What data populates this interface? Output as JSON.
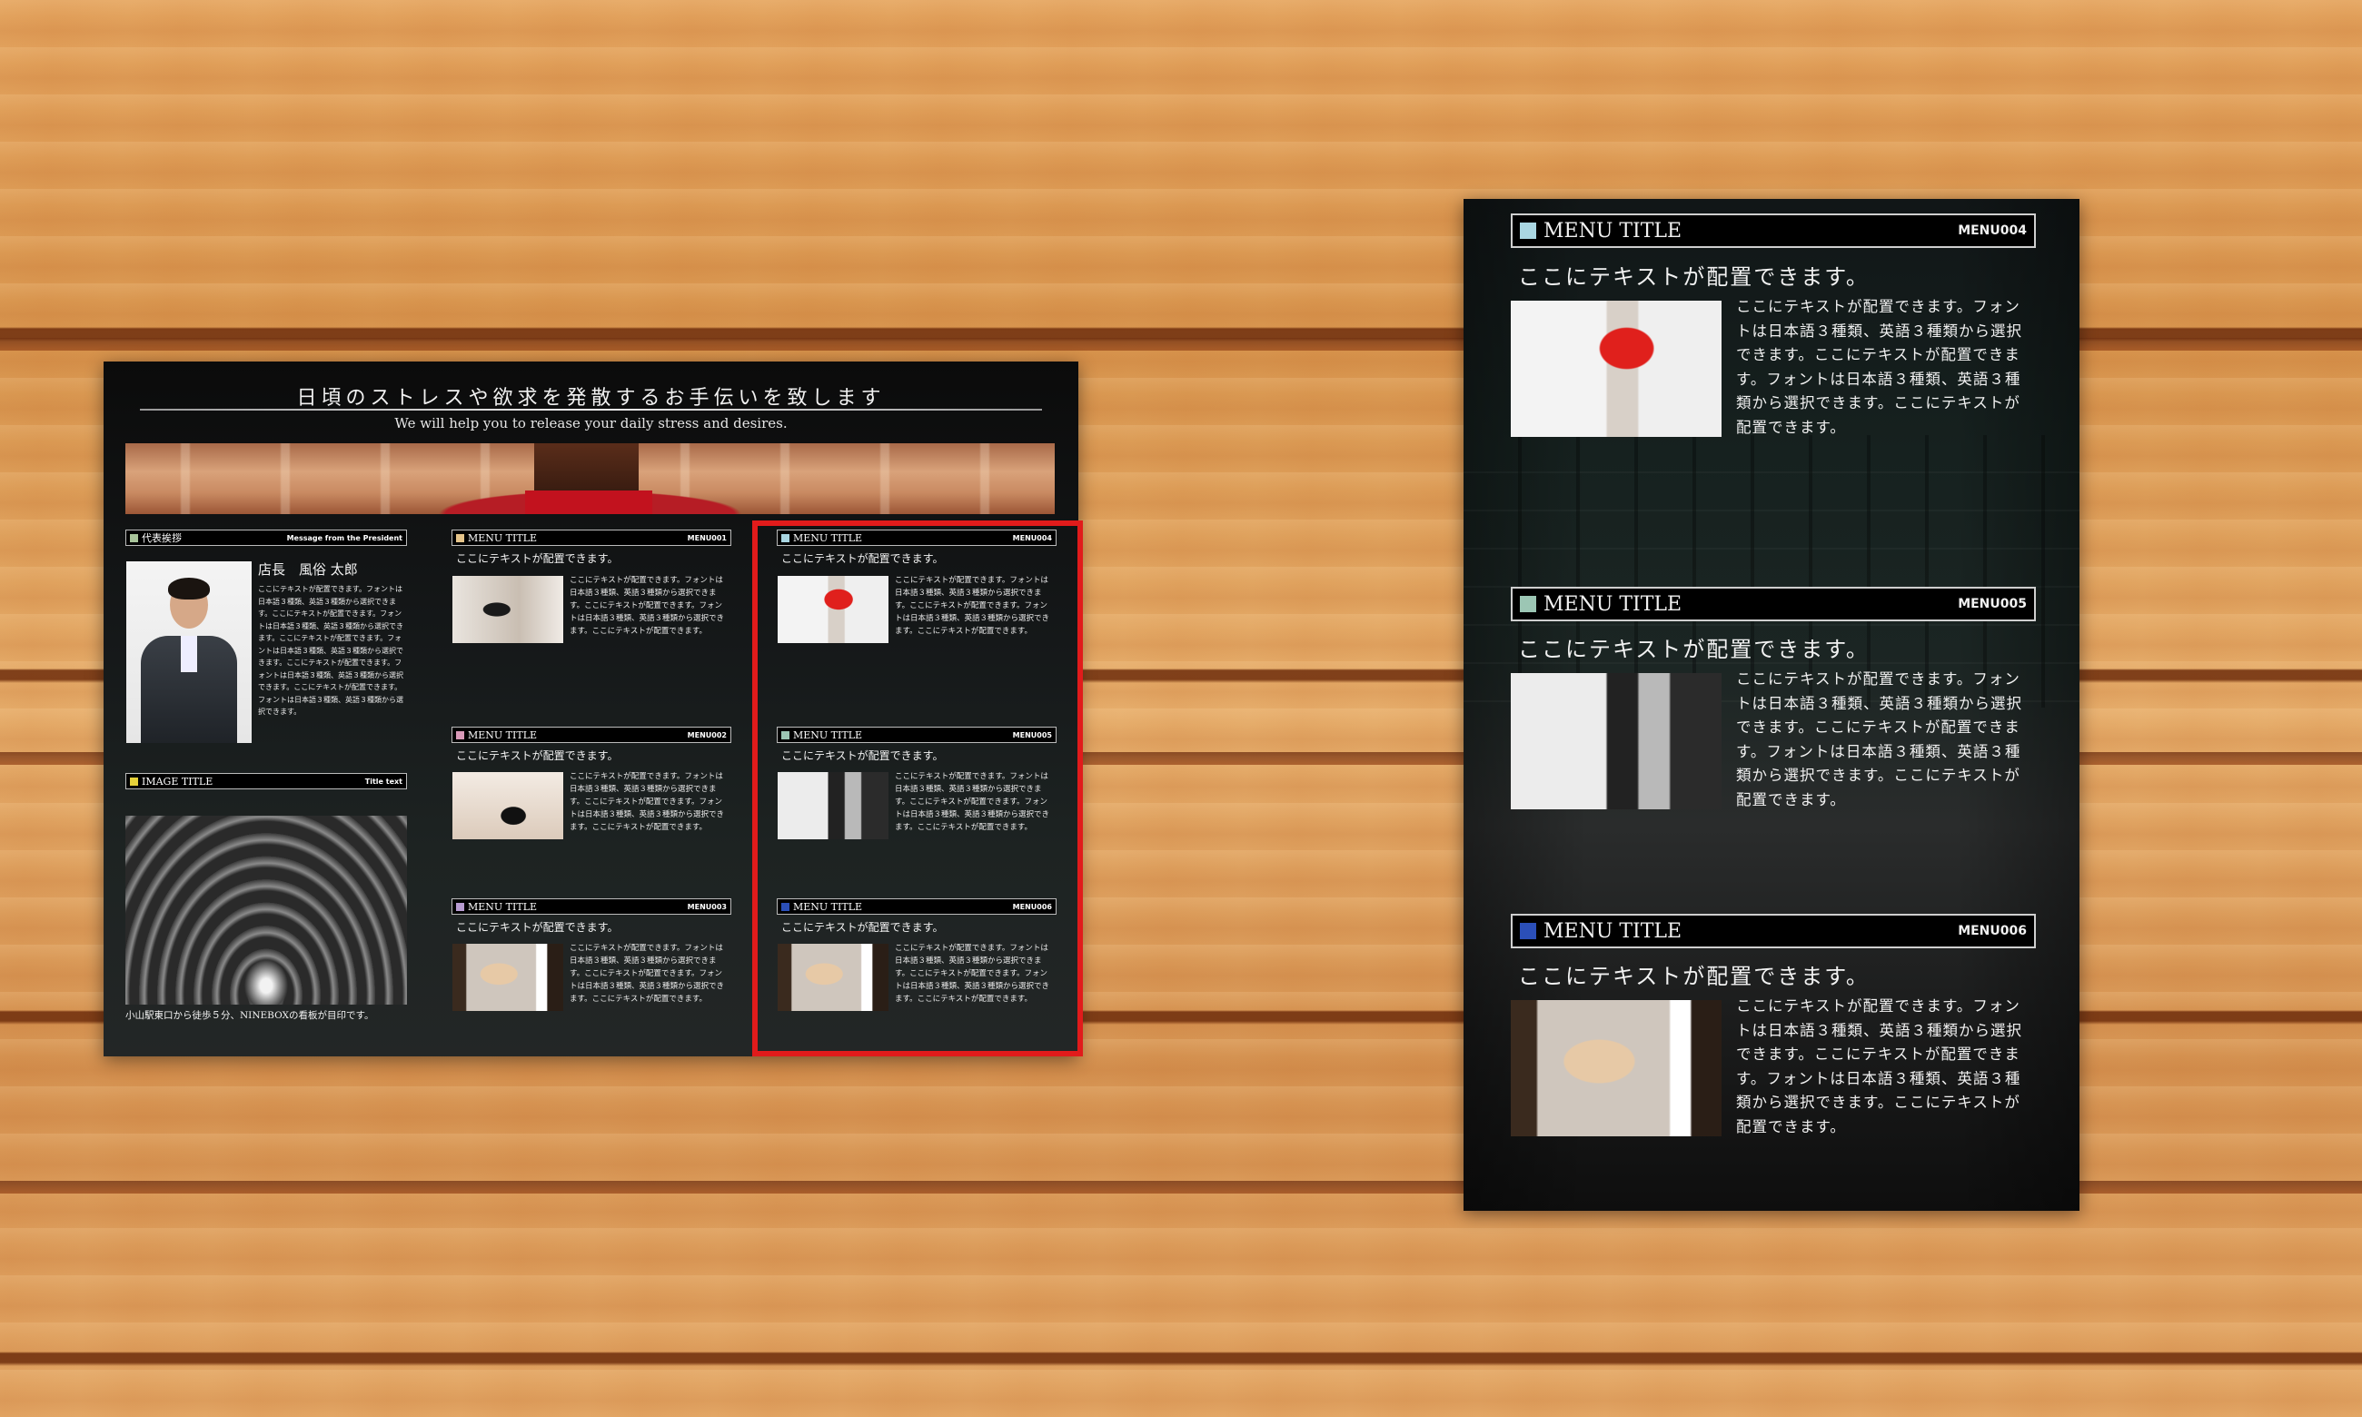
{
  "colors": {
    "frame_highlight": "#e11b1b",
    "sq_president": "#a8c49a",
    "sq_image": "#e7d23a",
    "sq_menu001": "#e5c48a",
    "sq_menu002": "#d99ab8",
    "sq_menu003": "#b79bd0",
    "sq_menu004": "#a9d6e2",
    "sq_menu005": "#9cc6b4",
    "sq_menu006": "#2b4fb8"
  },
  "left_page": {
    "title": "日頃のストレスや欲求を発散するお手伝いを致します",
    "subtitle": "We will help you to release your daily stress and desires.",
    "president": {
      "header_label": "代表挨拶",
      "header_right": "Message from the President",
      "name": "店長　風俗 太郎",
      "body": "ここにテキストが配置できます。フォントは日本語３種類、英語３種類から選択できます。ここにテキストが配置できます。フォントは日本語３種類、英語３種類から選択できます。ここにテキストが配置できます。フォントは日本語３種類、英語３種類から選択できます。ここにテキストが配置できます。フォントは日本語３種類、英語３種類から選択できます。ここにテキストが配置できます。フォントは日本語３種類、英語３種類から選択できます。"
    },
    "image_section": {
      "header_label": "IMAGE TITLE",
      "header_right": "Title text",
      "caption": "小山駅東口から徒歩５分、NINEBOXの看板が目印です。"
    },
    "menus": [
      {
        "label": "MENU TITLE",
        "code": "MENU001",
        "sub": "ここにテキストが配置できます。",
        "body": "ここにテキストが配置できます。フォントは日本語３種類、英語３種類から選択できます。ここにテキストが配置できます。フォントは日本語３種類、英語３種類から選択できます。ここにテキストが配置できます。"
      },
      {
        "label": "MENU TITLE",
        "code": "MENU002",
        "sub": "ここにテキストが配置できます。",
        "body": "ここにテキストが配置できます。フォントは日本語３種類、英語３種類から選択できます。ここにテキストが配置できます。フォントは日本語３種類、英語３種類から選択できます。ここにテキストが配置できます。"
      },
      {
        "label": "MENU TITLE",
        "code": "MENU003",
        "sub": "ここにテキストが配置できます。",
        "body": "ここにテキストが配置できます。フォントは日本語３種類、英語３種類から選択できます。ここにテキストが配置できます。フォントは日本語３種類、英語３種類から選択できます。ここにテキストが配置できます。"
      },
      {
        "label": "MENU TITLE",
        "code": "MENU004",
        "sub": "ここにテキストが配置できます。",
        "body": "ここにテキストが配置できます。フォントは日本語３種類、英語３種類から選択できます。ここにテキストが配置できます。フォントは日本語３種類、英語３種類から選択できます。ここにテキストが配置できます。"
      },
      {
        "label": "MENU TITLE",
        "code": "MENU005",
        "sub": "ここにテキストが配置できます。",
        "body": "ここにテキストが配置できます。フォントは日本語３種類、英語３種類から選択できます。ここにテキストが配置できます。フォントは日本語３種類、英語３種類から選択できます。ここにテキストが配置できます。"
      },
      {
        "label": "MENU TITLE",
        "code": "MENU006",
        "sub": "ここにテキストが配置できます。",
        "body": "ここにテキストが配置できます。フォントは日本語３種類、英語３種類から選択できます。ここにテキストが配置できます。フォントは日本語３種類、英語３種類から選択できます。ここにテキストが配置できます。"
      }
    ]
  },
  "right_page": {
    "menus": [
      {
        "label": "MENU TITLE",
        "code": "MENU004",
        "sub": "ここにテキストが配置できます。",
        "body": "ここにテキストが配置できます。フォントは日本語３種類、英語３種類から選択できます。ここにテキストが配置できます。フォントは日本語３種類、英語３種類から選択できます。ここにテキストが配置できます。"
      },
      {
        "label": "MENU TITLE",
        "code": "MENU005",
        "sub": "ここにテキストが配置できます。",
        "body": "ここにテキストが配置できます。フォントは日本語３種類、英語３種類から選択できます。ここにテキストが配置できます。フォントは日本語３種類、英語３種類から選択できます。ここにテキストが配置できます。"
      },
      {
        "label": "MENU TITLE",
        "code": "MENU006",
        "sub": "ここにテキストが配置できます。",
        "body": "ここにテキストが配置できます。フォントは日本語３種類、英語３種類から選択できます。ここにテキストが配置できます。フォントは日本語３種類、英語３種類から選択できます。ここにテキストが配置できます。"
      }
    ]
  }
}
